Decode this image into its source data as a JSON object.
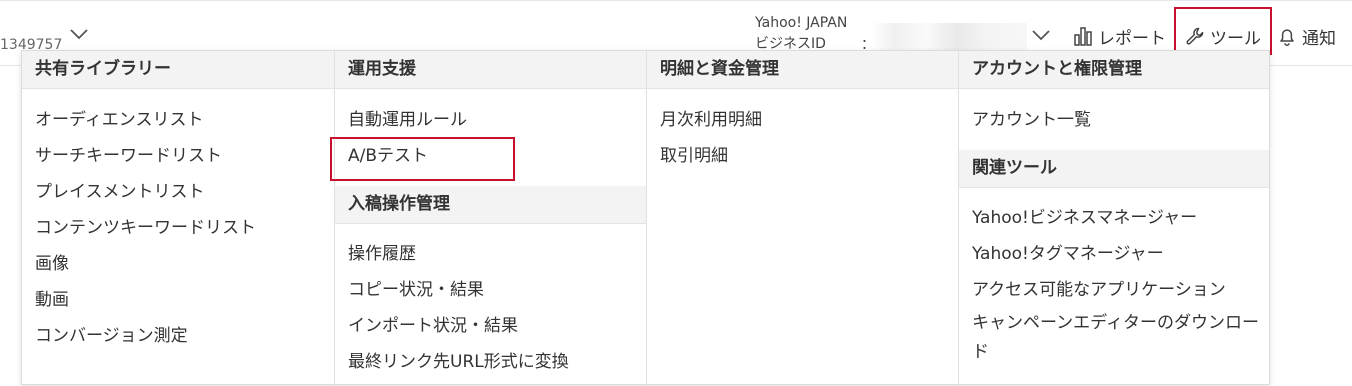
{
  "header": {
    "account_id": "1349757",
    "yahoo_line1": "Yahoo! JAPAN",
    "yahoo_line2": "ビジネスID",
    "colon": "：",
    "report_label": "レポート",
    "tool_label": "ツール",
    "notify_label": "通知"
  },
  "menu": {
    "col1": {
      "heading": "共有ライブラリー",
      "items": [
        "オーディエンスリスト",
        "サーチキーワードリスト",
        "プレイスメントリスト",
        "コンテンツキーワードリスト",
        "画像",
        "動画",
        "コンバージョン測定"
      ]
    },
    "col2": {
      "heading": "運用支援",
      "items": [
        "自動運用ルール",
        "A/Bテスト"
      ],
      "heading2": "入稿操作管理",
      "items2": [
        "操作履歴",
        "コピー状況・結果",
        "インポート状況・結果",
        "最終リンク先URL形式に変換"
      ]
    },
    "col3": {
      "heading": "明細と資金管理",
      "items": [
        "月次利用明細",
        "取引明細"
      ]
    },
    "col4": {
      "heading": "アカウントと権限管理",
      "items": [
        "アカウント一覧"
      ],
      "heading2": "関連ツール",
      "items2": [
        "Yahoo!ビジネスマネージャー",
        "Yahoo!タグマネージャー",
        "アクセス可能なアプリケーション",
        "キャンペーンエディターのダウンロード"
      ]
    }
  },
  "colors": {
    "highlight": "#c8102e",
    "section_bg": "#f3f3f3"
  }
}
